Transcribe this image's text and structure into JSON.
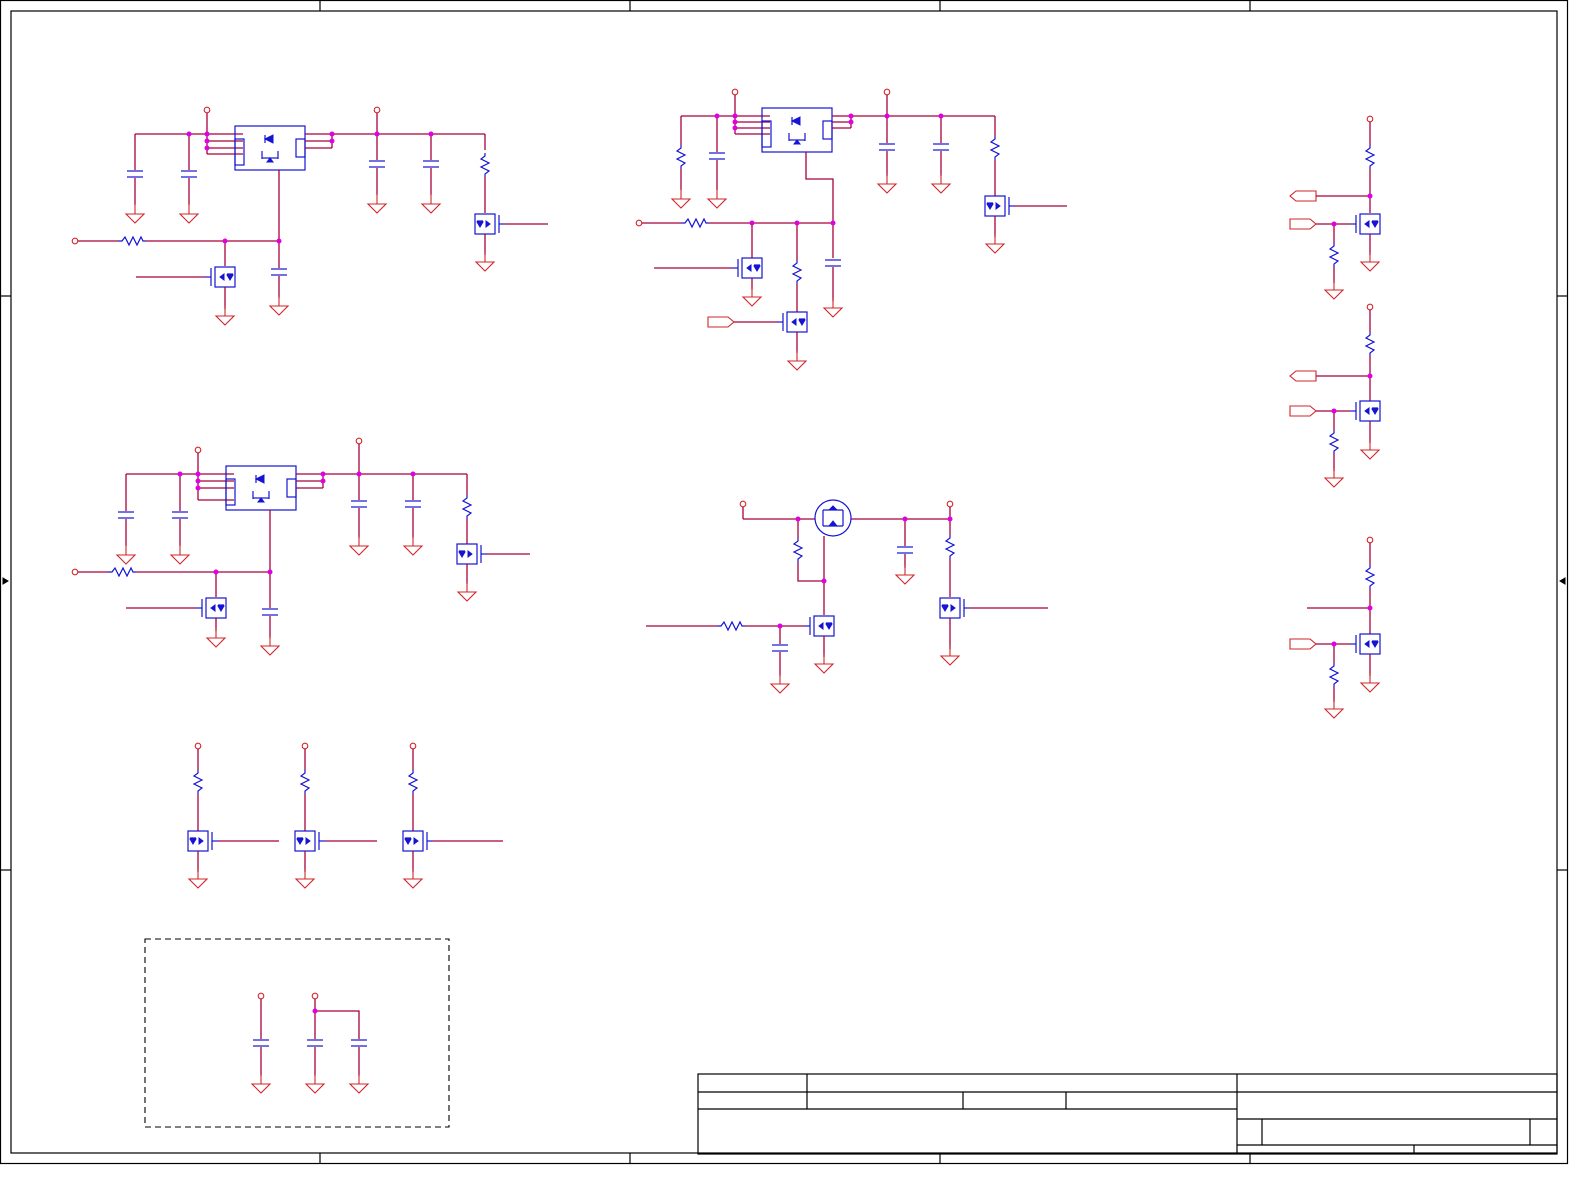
{
  "document": {
    "type": "circuit-schematic",
    "colors": {
      "wire": "#a8003c",
      "supply_and_ground": "#d0252a",
      "component": "#1414d2",
      "junction": "#e000e0",
      "frame": "#000000",
      "background": "#ffffff"
    },
    "border_zone_labels": [],
    "title_block": {
      "cells": []
    },
    "optional_group": {
      "label": ""
    },
    "net_labels": []
  }
}
